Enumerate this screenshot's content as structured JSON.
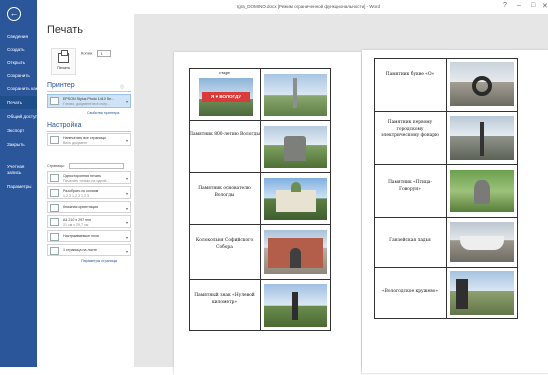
{
  "window": {
    "title": "Igra_DOMINO.docx [Режим ограниченной функциональности] - Word"
  },
  "sidebar": {
    "items": [
      {
        "label": "Сведения"
      },
      {
        "label": "Создать"
      },
      {
        "label": "Открыть"
      },
      {
        "label": "Сохранить"
      },
      {
        "label": "Сохранить как"
      },
      {
        "label": "Печать"
      },
      {
        "label": "Общий доступ"
      },
      {
        "label": "Экспорт"
      },
      {
        "label": "Закрыть"
      },
      {
        "label": "Учетная запись"
      },
      {
        "label": "Параметры"
      }
    ]
  },
  "print": {
    "title": "Печать",
    "print_button": "Печать",
    "copies_label": "Копии:",
    "copies_value": "1",
    "printer_heading": "Принтер",
    "printer_name": "EPSON Stylus Photo 1410 Se...",
    "printer_status": "Готово, документов в очер...",
    "printer_properties": "Свойства принтера",
    "settings_heading": "Настройка",
    "settings": [
      {
        "line1": "Напечатать все страницы",
        "line2": "Весь документ"
      },
      {
        "line1": "Односторонняя печать",
        "line2": "Печатать только на одной..."
      },
      {
        "line1": "Разобрать по копиям",
        "line2": "1,2,3   1,2,3   1,2,3"
      },
      {
        "line1": "Книжная ориентация",
        "line2": ""
      },
      {
        "line1": "А4 210 x 297 mm",
        "line2": "21 см x 29,7 см"
      },
      {
        "line1": "Настраиваемые поля",
        "line2": ""
      },
      {
        "line1": "1 страница на листе",
        "line2": ""
      }
    ],
    "pages_label": "Страницы:",
    "page_setup": "Параметры страницы"
  },
  "preview": {
    "left_page": [
      {
        "text": "старт"
      },
      {
        "text": "Памятник 800-летию Вологды"
      },
      {
        "text": "Памятник основателю Вологды"
      },
      {
        "text": "Колокольня Софийского Собора"
      },
      {
        "text": "Памятный знак «Нулевой километр»"
      }
    ],
    "right_page": [
      {
        "text": "Памятник букве «О»"
      },
      {
        "text": "Памятник первому городскому электрическому фонарю"
      },
      {
        "text": "Памятник «Птица- Говорун»"
      },
      {
        "text": "Ганзейская ладья"
      },
      {
        "text": "«Вологодское кружево»"
      }
    ],
    "banner_text": "Я ♥ ВОЛОГДУ"
  },
  "colors": {
    "accent": "#2b579a"
  }
}
